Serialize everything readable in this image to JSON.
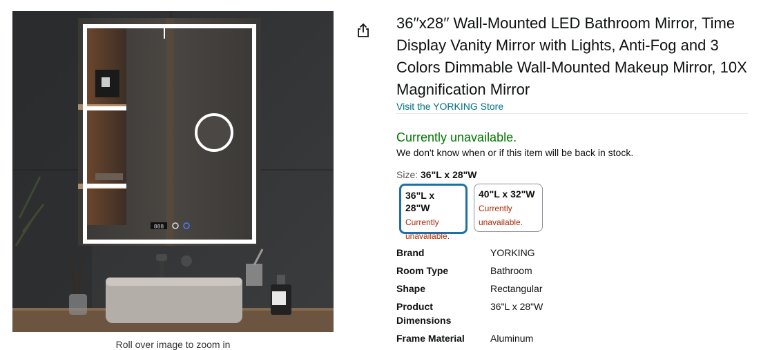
{
  "product": {
    "title": "36′′x28′′ Wall-Mounted LED Bathroom Mirror, Time Display Vanity Mirror with Lights, Anti-Fog and 3 Colors Dimmable Wall-Mounted Makeup Mirror, 10X Magnification Mirror",
    "store_link": "Visit the YORKING Store"
  },
  "image": {
    "zoom_hint": "Roll over image to zoom in"
  },
  "availability": {
    "status": "Currently unavailable.",
    "note": "We don't know when or if this item will be back in stock."
  },
  "size": {
    "label": "Size:",
    "selected": "36\"L x 28\"W",
    "options": [
      {
        "name": "36\"L x 28\"W",
        "status": "Currently unavailable.",
        "selected": true
      },
      {
        "name": "40\"L x 32\"W",
        "status": "Currently unavailable.",
        "selected": false
      }
    ]
  },
  "specs": [
    {
      "label": "Brand",
      "value": "YORKING"
    },
    {
      "label": "Room Type",
      "value": "Bathroom"
    },
    {
      "label": "Shape",
      "value": "Rectangular"
    },
    {
      "label": "Product Dimensions",
      "value": "36\"L x 28\"W"
    },
    {
      "label": "Frame Material",
      "value": "Aluminum"
    }
  ],
  "icons": {
    "share": "share-icon"
  },
  "colors": {
    "link": "#007185",
    "available": "#007600",
    "unavailable": "#b12704",
    "selected_border": "#1f6fa6"
  }
}
